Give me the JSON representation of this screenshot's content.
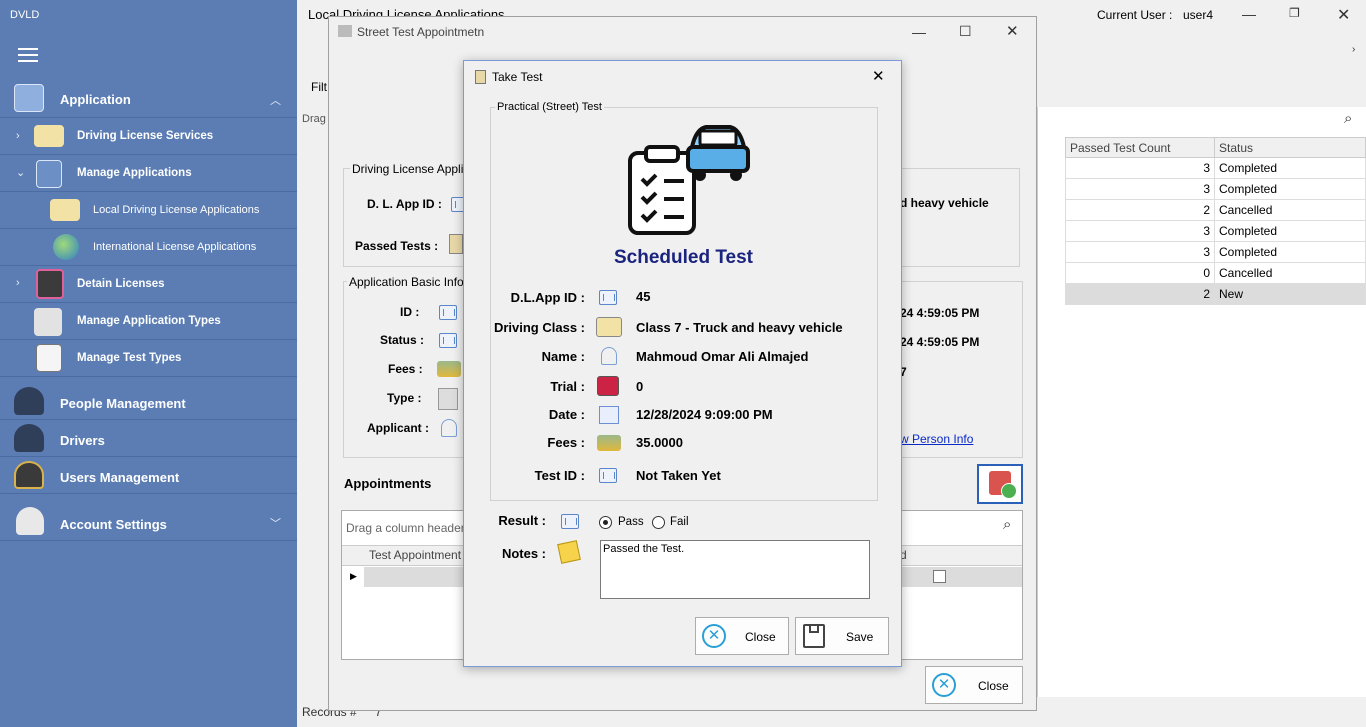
{
  "app_title": "DVLD",
  "sidebar": {
    "items": [
      {
        "label": "Application"
      },
      {
        "label": "Driving License Services"
      },
      {
        "label": "Manage Applications"
      },
      {
        "label": "Local Driving License Applications"
      },
      {
        "label": "International License Applications"
      },
      {
        "label": "Detain Licenses"
      },
      {
        "label": "Manage Application Types"
      },
      {
        "label": "Manage Test Types"
      },
      {
        "label": "People Management"
      },
      {
        "label": "Drivers"
      },
      {
        "label": "Users Management"
      },
      {
        "label": "Account Settings"
      }
    ]
  },
  "main": {
    "title": "Local Driving License Applications",
    "current_user_label": "Current User :",
    "current_user": "user4",
    "filter_label": "Filt",
    "drag_label": "Drag",
    "records_label": "Records #",
    "records_value": "7",
    "grid": {
      "headers": [
        "Passed Test Count",
        "Status"
      ],
      "rows": [
        [
          "3",
          "Completed"
        ],
        [
          "3",
          "Completed"
        ],
        [
          "2",
          "Cancelled"
        ],
        [
          "3",
          "Completed"
        ],
        [
          "3",
          "Completed"
        ],
        [
          "0",
          "Cancelled"
        ],
        [
          "2",
          "New"
        ]
      ]
    }
  },
  "street": {
    "title": "Street Test Appointmetn",
    "dl_group": "Driving License Applicat",
    "dl_app_id_label": "D. L. App ID :",
    "passed_tests_label": "Passed Tests :",
    "class_partial": "d heavy vehicle",
    "basic_group": "Application Basic Info",
    "id_label": "ID :",
    "status_label": "Status :",
    "fees_label": "Fees :",
    "type_label": "Type :",
    "applicant_label": "Applicant :",
    "date1": "24 4:59:05 PM",
    "date2": "24 4:59:05 PM",
    "partial_num": "7",
    "view_person": "w Person Info",
    "appointments_label": "Appointments",
    "drag_header": "Drag a column header he",
    "col_appt_id": "Test Appointment I",
    "col_end": "d",
    "close": "Close"
  },
  "take": {
    "title": "Take Test",
    "group": "Practical (Street) Test",
    "heading": "Scheduled Test",
    "fields": [
      {
        "label": "D.L.App ID :",
        "value": "45"
      },
      {
        "label": "Driving Class :",
        "value": "Class 7 - Truck and heavy vehicle"
      },
      {
        "label": "Name :",
        "value": "Mahmoud Omar Ali Almajed"
      },
      {
        "label": "Trial :",
        "value": "0"
      },
      {
        "label": "Date :",
        "value": "12/28/2024 9:09:00 PM"
      },
      {
        "label": "Fees :",
        "value": "35.0000"
      },
      {
        "label": "Test ID :",
        "value": "Not Taken Yet"
      }
    ],
    "result_label": "Result :",
    "pass": "Pass",
    "fail": "Fail",
    "notes_label": "Notes :",
    "notes": "Passed the Test.",
    "close": "Close",
    "save": "Save"
  },
  "colors": {
    "sidebar": "#5b7db3",
    "heading": "#1a237e",
    "selection": "#dcdcdc"
  }
}
